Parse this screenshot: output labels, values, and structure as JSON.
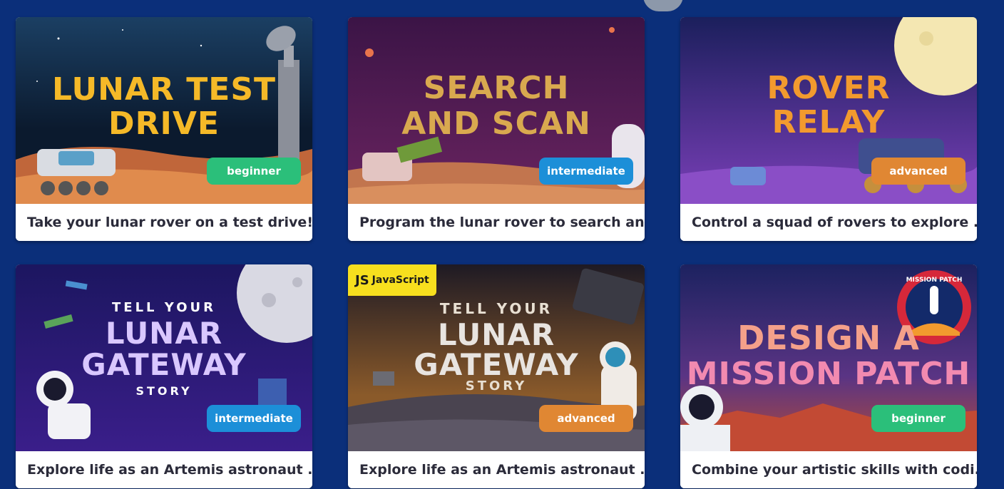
{
  "cards": [
    {
      "art_lines": [
        "LUNAR TEST",
        "DRIVE"
      ],
      "level": "beginner",
      "caption": "Take your lunar rover on a test drive!"
    },
    {
      "art_lines": [
        "SEARCH",
        "AND SCAN"
      ],
      "level": "intermediate",
      "caption": "Program the lunar rover to search an..."
    },
    {
      "art_lines": [
        "ROVER",
        "RELAY"
      ],
      "level": "advanced",
      "caption": "Control a squad of rovers to explore ..."
    },
    {
      "art_lines": [
        "TELL YOUR",
        "LUNAR",
        "GATEWAY",
        "STORY"
      ],
      "level": "intermediate",
      "caption": "Explore life as an Artemis astronaut ..."
    },
    {
      "art_lines": [
        "TELL YOUR",
        "LUNAR",
        "GATEWAY",
        "STORY"
      ],
      "level": "advanced",
      "caption": "Explore life as an Artemis astronaut ...",
      "language_badge": {
        "icon": "JS",
        "label": "JavaScript"
      }
    },
    {
      "art_lines": [
        "DESIGN A",
        "MISSION PATCH"
      ],
      "level": "beginner",
      "caption": "Combine your artistic skills with codi...",
      "patch_text": "MISSION PATCH"
    }
  ],
  "colors": {
    "page_background": "#0b2f7a",
    "beginner": "#2bbf7a",
    "intermediate": "#1c8fd8",
    "advanced": "#e08733",
    "javascript_badge": "#f7df1e"
  }
}
